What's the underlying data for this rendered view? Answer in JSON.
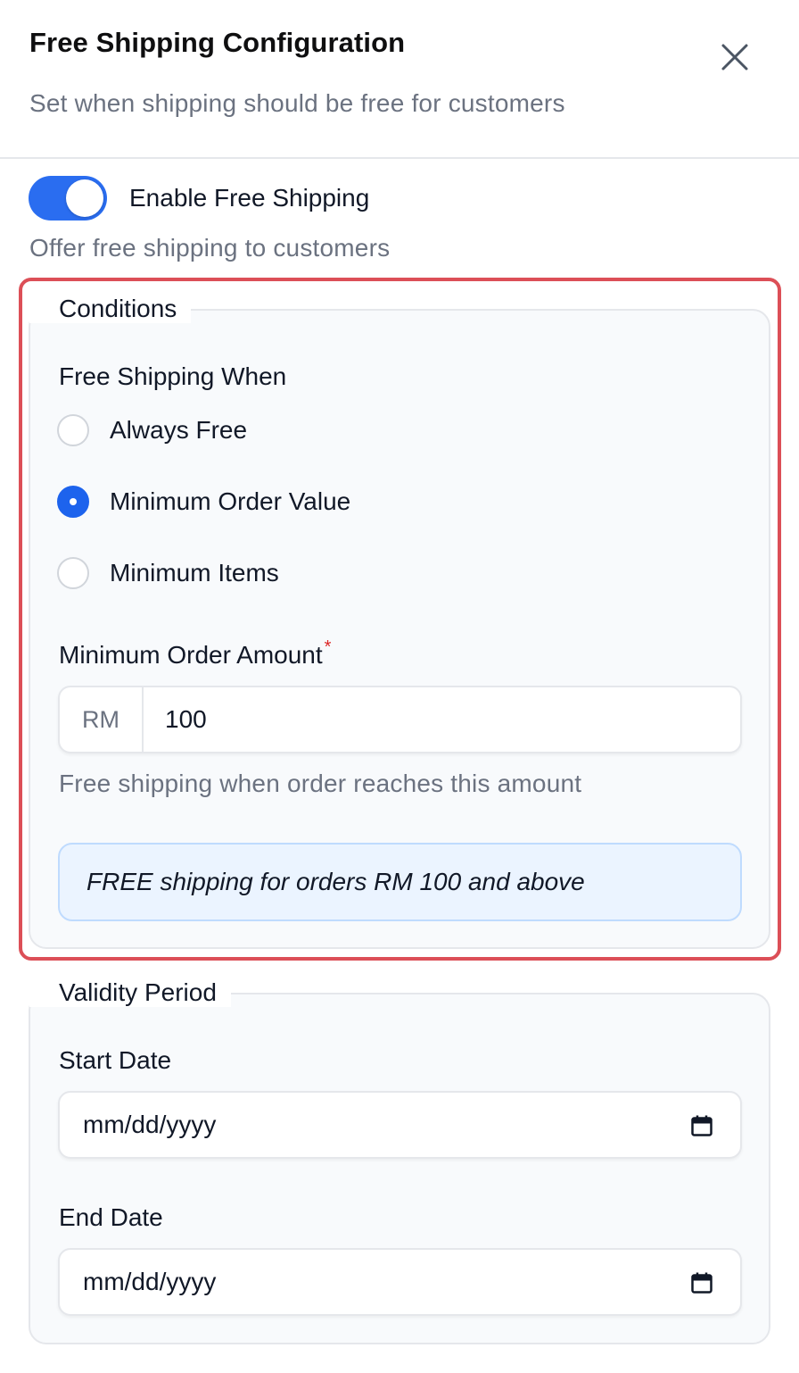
{
  "header": {
    "title": "Free Shipping Configuration",
    "subtitle": "Set when shipping should be free for customers",
    "close_icon": "close-icon"
  },
  "toggle": {
    "label": "Enable Free Shipping",
    "description": "Offer free shipping to customers",
    "enabled": true,
    "color": "#2a6df0"
  },
  "conditions": {
    "legend": "Conditions",
    "free_shipping_when_label": "Free Shipping When",
    "options": [
      {
        "label": "Always Free",
        "checked": false
      },
      {
        "label": "Minimum Order Value",
        "checked": true
      },
      {
        "label": "Minimum Items",
        "checked": false
      }
    ],
    "min_amount_label": "Minimum Order Amount",
    "required_mark": "*",
    "currency_prefix": "RM",
    "amount_value": "100",
    "help_text": "Free shipping when order reaches this amount",
    "summary": "FREE shipping for orders RM 100 and above",
    "highlight_color": "#dc4f57"
  },
  "validity": {
    "legend": "Validity Period",
    "start_label": "Start Date",
    "start_placeholder": "mm/dd/yyyy",
    "end_label": "End Date",
    "end_placeholder": "mm/dd/yyyy",
    "calendar_icon": "calendar-icon"
  }
}
